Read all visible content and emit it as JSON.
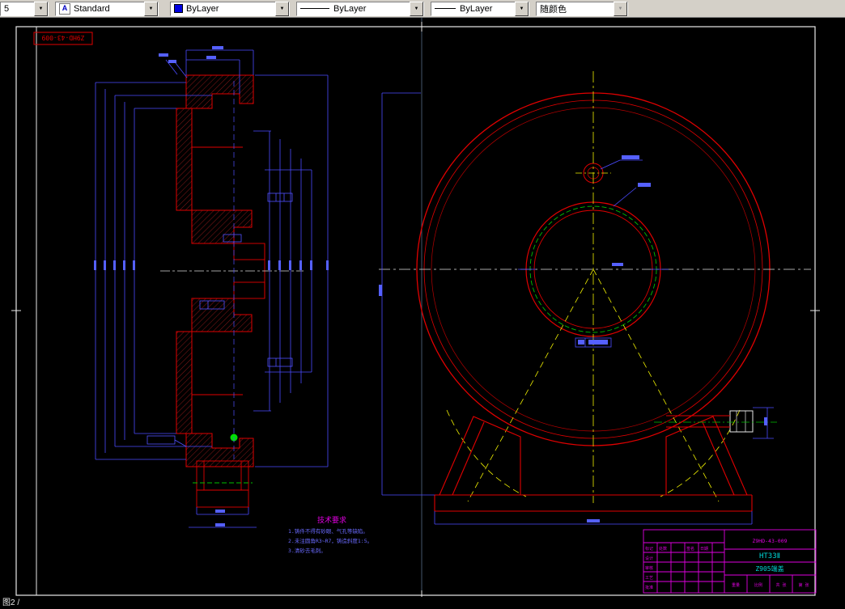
{
  "toolbar": {
    "layer_combo": "5",
    "style_combo": "Standard",
    "style_icon": "A",
    "color_combo": "ByLayer",
    "linetype_combo": "ByLayer",
    "lineweight_combo": "ByLayer",
    "plotstyle_combo": "随颜色"
  },
  "drawing": {
    "corner_label": "Z9HD-43-009",
    "status_text": "图2 /",
    "tech_req": {
      "title": "技术要求",
      "lines": [
        "1.铸件不得有砂眼、气孔等缺陷。",
        "2.未注圆角R3~R7，铸造斜度1:5。",
        "3.清砂去毛刺。"
      ]
    },
    "title_block": {
      "drawing_no": "Z9HD-43-009",
      "material": "HT33Ⅱ",
      "part_name": "Z905端盖",
      "header_labels": [
        "标记",
        "处数",
        "签名",
        "日期"
      ],
      "row_labels": [
        "设计",
        "审核",
        "工艺",
        "批准"
      ],
      "bottom_labels": [
        "重量",
        "比例",
        "共 张",
        "第 张"
      ]
    },
    "colors": {
      "entity_red": "#e00000",
      "dim_blue": "#5050ff",
      "center_yellow": "#f0f000",
      "annot_magenta": "#e000e0",
      "annot_cyan": "#00d8d8",
      "aux_green": "#00c000"
    }
  }
}
